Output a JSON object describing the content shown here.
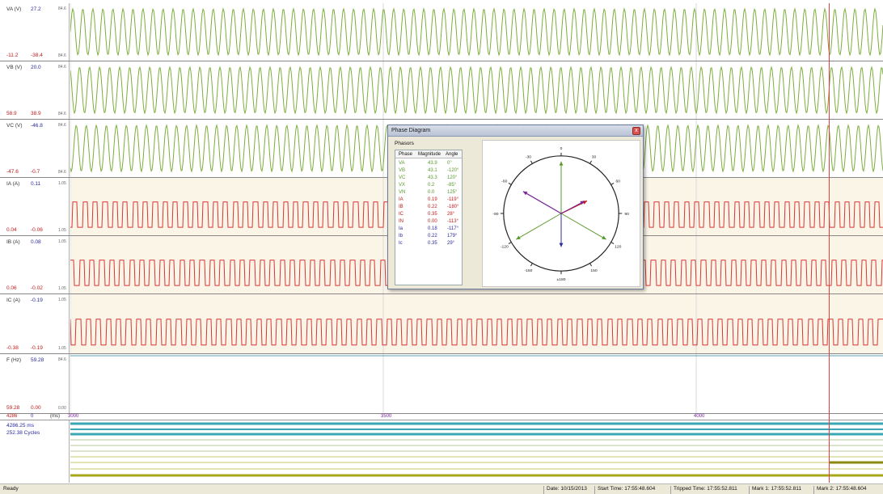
{
  "colors": {
    "voltage_wave": "#7cae3c",
    "current_wave": "#d83434",
    "current_bg": "#fbf5e8",
    "red_text": "#c21a1a",
    "blue_text": "#2a2aa0",
    "axis_text": "#7a1fa0",
    "dialog_bg": "#ece9d8"
  },
  "channels": [
    {
      "name": "VA (V)",
      "current": "27.2",
      "min": "-11.2",
      "max": "-38.4",
      "scale_top": "84.6",
      "scale_bottom": "84.6",
      "kind": "voltage"
    },
    {
      "name": "VB (V)",
      "current": "20.0",
      "min": "58.9",
      "max": "38.9",
      "scale_top": "84.6",
      "scale_bottom": "84.6",
      "kind": "voltage"
    },
    {
      "name": "VC (V)",
      "current": "-46.8",
      "min": "-47.6",
      "max": "-0.7",
      "scale_top": "84.6",
      "scale_bottom": "84.6",
      "kind": "voltage"
    },
    {
      "name": "IA (A)",
      "current": "0.11",
      "min": "0.04",
      "max": "-0.06",
      "scale_top": "1.05",
      "scale_bottom": "1.05",
      "kind": "current"
    },
    {
      "name": "IB (A)",
      "current": "0.08",
      "min": "0.06",
      "max": "-0.02",
      "scale_top": "1.05",
      "scale_bottom": "1.05",
      "kind": "current"
    },
    {
      "name": "IC (A)",
      "current": "-0.19",
      "min": "-0.38",
      "max": "-0.19",
      "scale_top": "1.05",
      "scale_bottom": "1.05",
      "kind": "current"
    },
    {
      "name": "F (Hz)",
      "current": "59.28",
      "min": "59.28",
      "max": "0.00",
      "scale_top": "84.6",
      "scale_bottom": "0.00",
      "kind": "flat"
    }
  ],
  "axis": {
    "left_value": "4286",
    "left_zero": "0",
    "unit": "(ms)",
    "ticks": [
      "3000",
      "3500",
      "4000"
    ]
  },
  "digital": {
    "duration_ms": "4286.25 ms",
    "cycles": "252.38 Cycles"
  },
  "phase_diagram": {
    "title": "Phase Diagram",
    "close_label": "x",
    "group_label": "Phasors",
    "columns": [
      "Phase",
      "Magnitude",
      "Angle"
    ],
    "rows": [
      {
        "phase": "VA",
        "magnitude": "43.9",
        "angle": "0°",
        "color": "#5a9a2a"
      },
      {
        "phase": "VB",
        "magnitude": "43.1",
        "angle": "-120°",
        "color": "#5a9a2a"
      },
      {
        "phase": "VC",
        "magnitude": "43.3",
        "angle": "120°",
        "color": "#5a9a2a"
      },
      {
        "phase": "VX",
        "magnitude": "0.2",
        "angle": "-85°",
        "color": "#5a9a2a"
      },
      {
        "phase": "VN",
        "magnitude": "0.0",
        "angle": "125°",
        "color": "#5a9a2a"
      },
      {
        "phase": "IA",
        "magnitude": "0.19",
        "angle": "-119°",
        "color": "#c21a1a"
      },
      {
        "phase": "IB",
        "magnitude": "0.22",
        "angle": "-180°",
        "color": "#c21a1a"
      },
      {
        "phase": "IC",
        "magnitude": "0.35",
        "angle": "28°",
        "color": "#c21a1a"
      },
      {
        "phase": "IN",
        "magnitude": "0.00",
        "angle": "-113°",
        "color": "#c21a1a"
      },
      {
        "phase": "Ia",
        "magnitude": "0.18",
        "angle": "-117°",
        "color": "#2a2aa0"
      },
      {
        "phase": "Ib",
        "magnitude": "0.22",
        "angle": "179°",
        "color": "#2a2aa0"
      },
      {
        "phase": "Ic",
        "magnitude": "0.35",
        "angle": "29°",
        "color": "#2a2aa0"
      }
    ],
    "polar_labels": [
      "0",
      "30",
      "60",
      "90",
      "120",
      "150",
      "±180",
      "-150",
      "-120",
      "-90",
      "-60",
      "-30"
    ]
  },
  "status": {
    "ready": "Ready",
    "date": "Date: 10/15/2013",
    "start_time": "Start Time: 17:55:48.604",
    "tripped_time": "Tripped Time: 17:55:52.811",
    "mark1": "Mark 1: 17:55:52.811",
    "mark2": "Mark 2: 17:55:48.604"
  }
}
